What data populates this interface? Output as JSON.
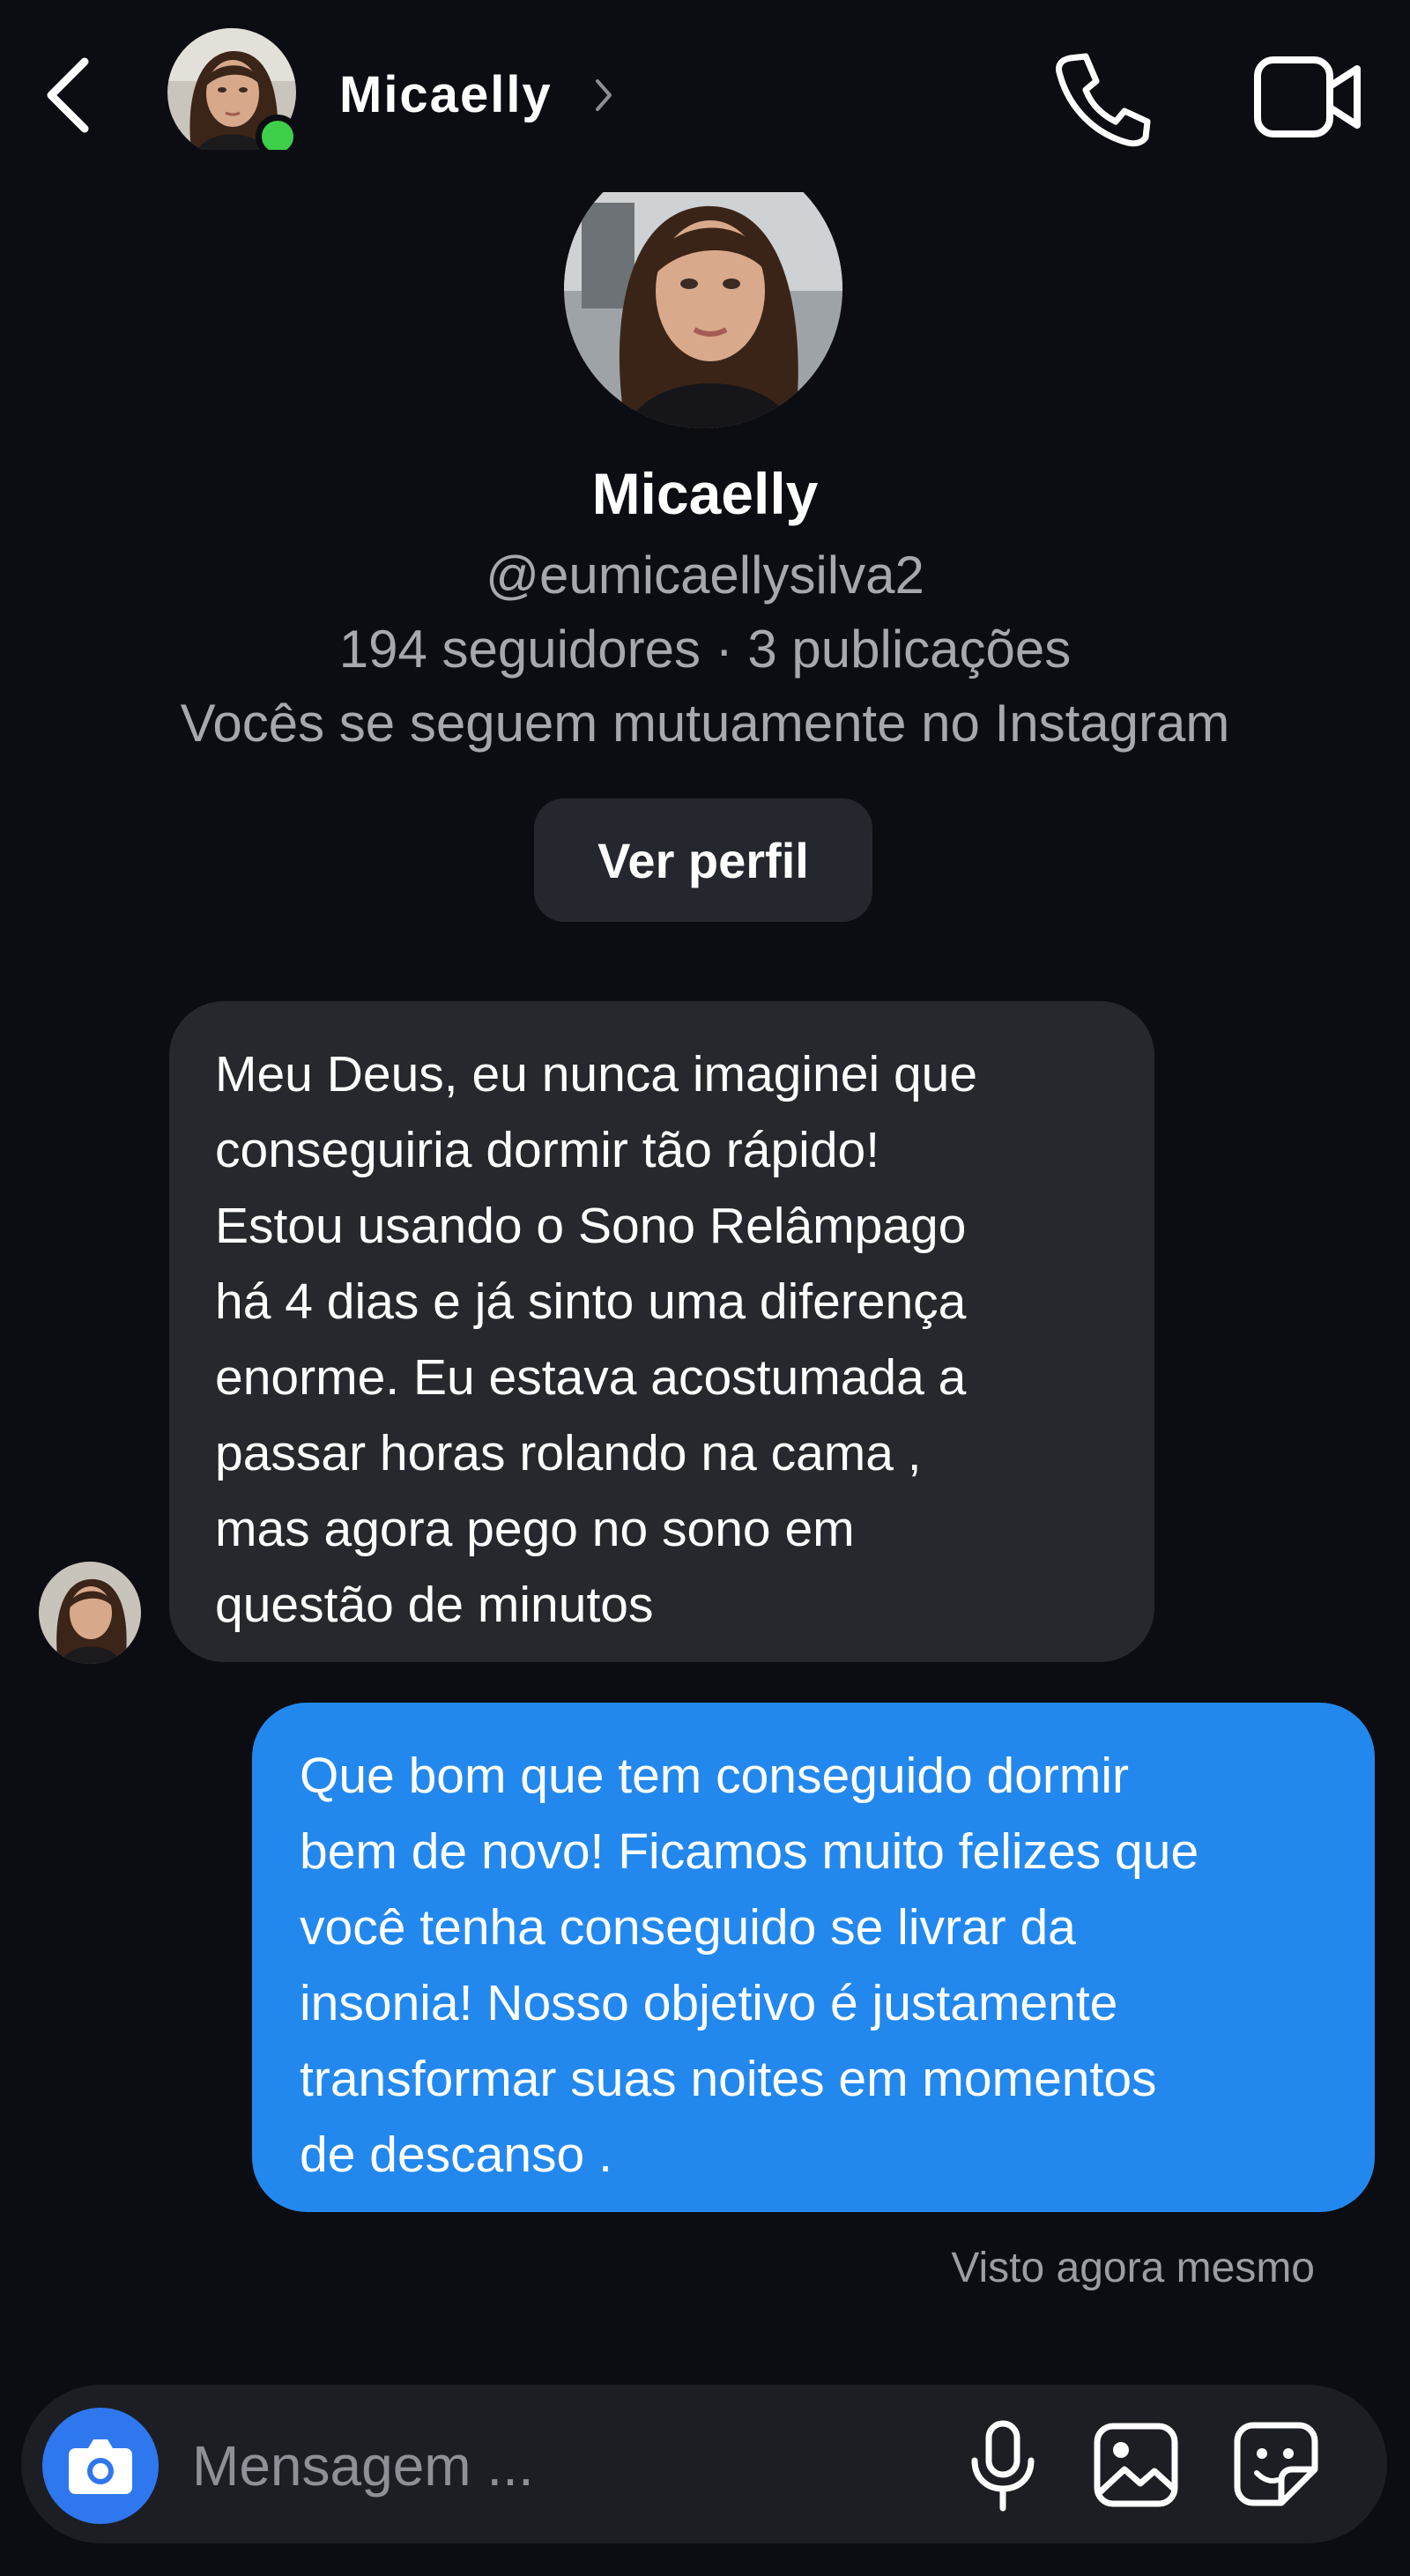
{
  "header": {
    "name": "Micaelly",
    "online": true
  },
  "profile": {
    "name": "Micaelly",
    "handle": "@eumicaellysilva2",
    "stats": "194  seguidores   · 3 publicações",
    "mutual": "Vocês  se seguem  mutuamente  no Instagram",
    "view_profile_label": "Ver perfil"
  },
  "messages": [
    {
      "direction": "incoming",
      "lines": [
        "Meu Deus, eu nunca imaginei que",
        "conseguiria dormir tão rápido!",
        "Estou usando o Sono Relâmpago",
        "há 4 dias e já sinto uma diferença",
        "enorme. Eu estava acostumada  a",
        "passar horas rolando na cama ,",
        "mas agora pego no sono em",
        "questão de minutos"
      ]
    },
    {
      "direction": "outgoing",
      "lines": [
        "Que bom que tem conseguido dormir",
        "bem de novo! Ficamos muito felizes que",
        "você tenha conseguido se livrar da",
        "insonia! Nosso objetivo é justamente",
        "transformar suas noites em momentos",
        "de descanso ."
      ]
    }
  ],
  "seen_status": "Visto agora  mesmo",
  "composer": {
    "placeholder": "Mensagem ..."
  },
  "colors": {
    "background": "#0c0d12",
    "incoming_bubble": "#26282e",
    "outgoing_bubble": "#2388ee",
    "online": "#3ecf4a",
    "camera_button": "#2f77ee"
  },
  "icons": [
    "back-arrow-icon",
    "chevron-right-icon",
    "phone-icon",
    "video-camera-icon",
    "camera-icon",
    "microphone-icon",
    "gallery-icon",
    "sticker-icon"
  ]
}
